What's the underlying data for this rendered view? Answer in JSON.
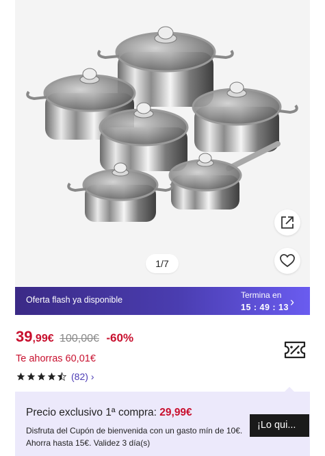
{
  "gallery": {
    "page_indicator": "1/7",
    "share_icon": "external-link-icon",
    "favorite_icon": "heart-icon"
  },
  "flash": {
    "text": "Oferta flash ya disponible",
    "ends_label": "Termina en",
    "timer": "15 : 49 : 13",
    "chevron": "›"
  },
  "price": {
    "current_int": "39",
    "current_dec": ",99€",
    "original": "100,00€",
    "discount": "-60%",
    "savings": "Te ahorras 60,01€"
  },
  "rating": {
    "stars": 4.5,
    "count": "(82)",
    "chevron": "›"
  },
  "promo": {
    "title": "Precio exclusivo 1ª compra:",
    "price": "29,99€",
    "description": "Disfruta del Cupón de bienvenida con un gasto mín de 10€. Ahorra hasta 15€. Validez 3 día(s)",
    "button_label": "¡Lo qui..."
  },
  "colors": {
    "accent_red": "#c8102e",
    "flash_start": "#3b2a86",
    "flash_end": "#6a5cf0",
    "promo_bg": "#ece9fb",
    "link_purple": "#4b3bb4"
  }
}
